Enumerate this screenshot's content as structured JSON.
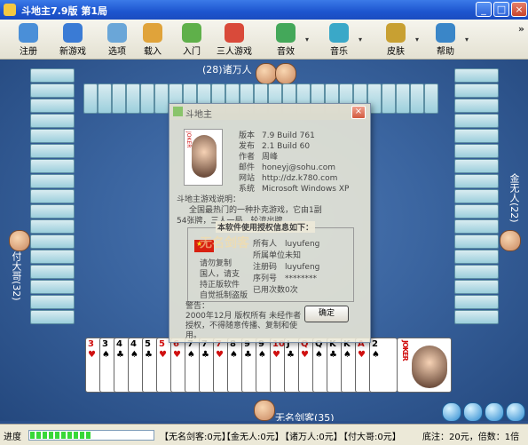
{
  "window": {
    "title": "斗地主7.9版 第1局",
    "minimize": "_",
    "maximize": "□",
    "close": "×"
  },
  "toolbar": {
    "buttons": [
      {
        "label": "注册",
        "icon": "user-register-icon",
        "color": "#4a8fd8"
      },
      {
        "label": "新游戏",
        "icon": "new-game-icon",
        "color": "#3a7bd5"
      },
      {
        "label": "选项",
        "icon": "options-icon",
        "color": "#6aa6d8"
      },
      {
        "label": "载入",
        "icon": "load-icon",
        "color": "#e0a33a"
      },
      {
        "label": "入门",
        "icon": "tutorial-icon",
        "color": "#5fb04a"
      },
      {
        "label": "三人游戏",
        "icon": "three-player-icon",
        "color": "#d94a3a"
      },
      {
        "label": "音效",
        "icon": "sound-icon",
        "color": "#44a85a"
      },
      {
        "label": "音乐",
        "icon": "music-icon",
        "color": "#3aa8c8"
      },
      {
        "label": "皮肤",
        "icon": "skin-icon",
        "color": "#c8a032"
      },
      {
        "label": "帮助",
        "icon": "help-icon",
        "color": "#3a86c8"
      }
    ],
    "more": "»"
  },
  "players": {
    "top": {
      "name": "(28)诸万人"
    },
    "left": {
      "name": "付大哥(32)"
    },
    "right": {
      "name": "金无人(22)"
    },
    "bottom": {
      "name": "无名剑客(35)"
    }
  },
  "hand": [
    {
      "rank": "3",
      "suit": "♥",
      "color": "red"
    },
    {
      "rank": "3",
      "suit": "♠",
      "color": "black"
    },
    {
      "rank": "4",
      "suit": "♣",
      "color": "black"
    },
    {
      "rank": "4",
      "suit": "♠",
      "color": "black"
    },
    {
      "rank": "5",
      "suit": "♣",
      "color": "black"
    },
    {
      "rank": "5",
      "suit": "♥",
      "color": "red"
    },
    {
      "rank": "6",
      "suit": "♥",
      "color": "red"
    },
    {
      "rank": "7",
      "suit": "♠",
      "color": "black"
    },
    {
      "rank": "7",
      "suit": "♣",
      "color": "black"
    },
    {
      "rank": "7",
      "suit": "♥",
      "color": "red"
    },
    {
      "rank": "8",
      "suit": "♠",
      "color": "black"
    },
    {
      "rank": "9",
      "suit": "♣",
      "color": "black"
    },
    {
      "rank": "9",
      "suit": "♠",
      "color": "black"
    },
    {
      "rank": "10",
      "suit": "♥",
      "color": "red"
    },
    {
      "rank": "J",
      "suit": "♣",
      "color": "black"
    },
    {
      "rank": "Q",
      "suit": "♥",
      "color": "red"
    },
    {
      "rank": "Q",
      "suit": "♠",
      "color": "black"
    },
    {
      "rank": "K",
      "suit": "♣",
      "color": "black"
    },
    {
      "rank": "K",
      "suit": "♠",
      "color": "black"
    },
    {
      "rank": "A",
      "suit": "♥",
      "color": "red"
    },
    {
      "rank": "2",
      "suit": "♠",
      "color": "black"
    }
  ],
  "joker": {
    "text": "JOKER"
  },
  "dialog": {
    "title": "斗地主",
    "close": "×",
    "photo_text": "JOKER",
    "info": [
      {
        "k": "版本",
        "v": "7.9 Build 761"
      },
      {
        "k": "发布",
        "v": "2.1 Build 60"
      },
      {
        "k": "作者",
        "v": "周峰"
      },
      {
        "k": "邮件",
        "v": "honeyj@sohu.com"
      },
      {
        "k": "网站",
        "v": "http://dz.k780.com"
      },
      {
        "k": "系统",
        "v": "Microsoft Windows XP"
      }
    ],
    "intro_title": "斗地主游戏说明：",
    "intro_line1": "全国最热门的一种扑克游戏，它由1副",
    "intro_line2": "54张牌，三人一局，轮流出牌。",
    "license_title": "本软件使用授权信息如下：",
    "license_left": [
      "请勿复制",
      "国人，请支",
      "持正版软件",
      "自觉抵制盗版"
    ],
    "license_rows": [
      {
        "k": "所有人",
        "v": "luyufeng"
      },
      {
        "k": "所属单位",
        "v": "未知"
      },
      {
        "k": "注册码",
        "v": "luyufeng"
      },
      {
        "k": "序列号",
        "v": "********"
      },
      {
        "k": "已用次数",
        "v": "0次"
      }
    ],
    "warn_line1": "警告：",
    "warn_line2": "2000年12月 版权所有 未经作者",
    "warn_line3": "授权，不得随意传播、复制和使",
    "warn_line4": "用。",
    "ok": "确定",
    "watermark": "无名剑客"
  },
  "status": {
    "label": "进度",
    "progress": 0.5,
    "items": [
      "【无名剑客:0元】",
      "【金无人:0元】",
      "【诸万人:0元】",
      "【付大哥:0元】"
    ],
    "right": "底注：20元，倍数：1倍"
  }
}
